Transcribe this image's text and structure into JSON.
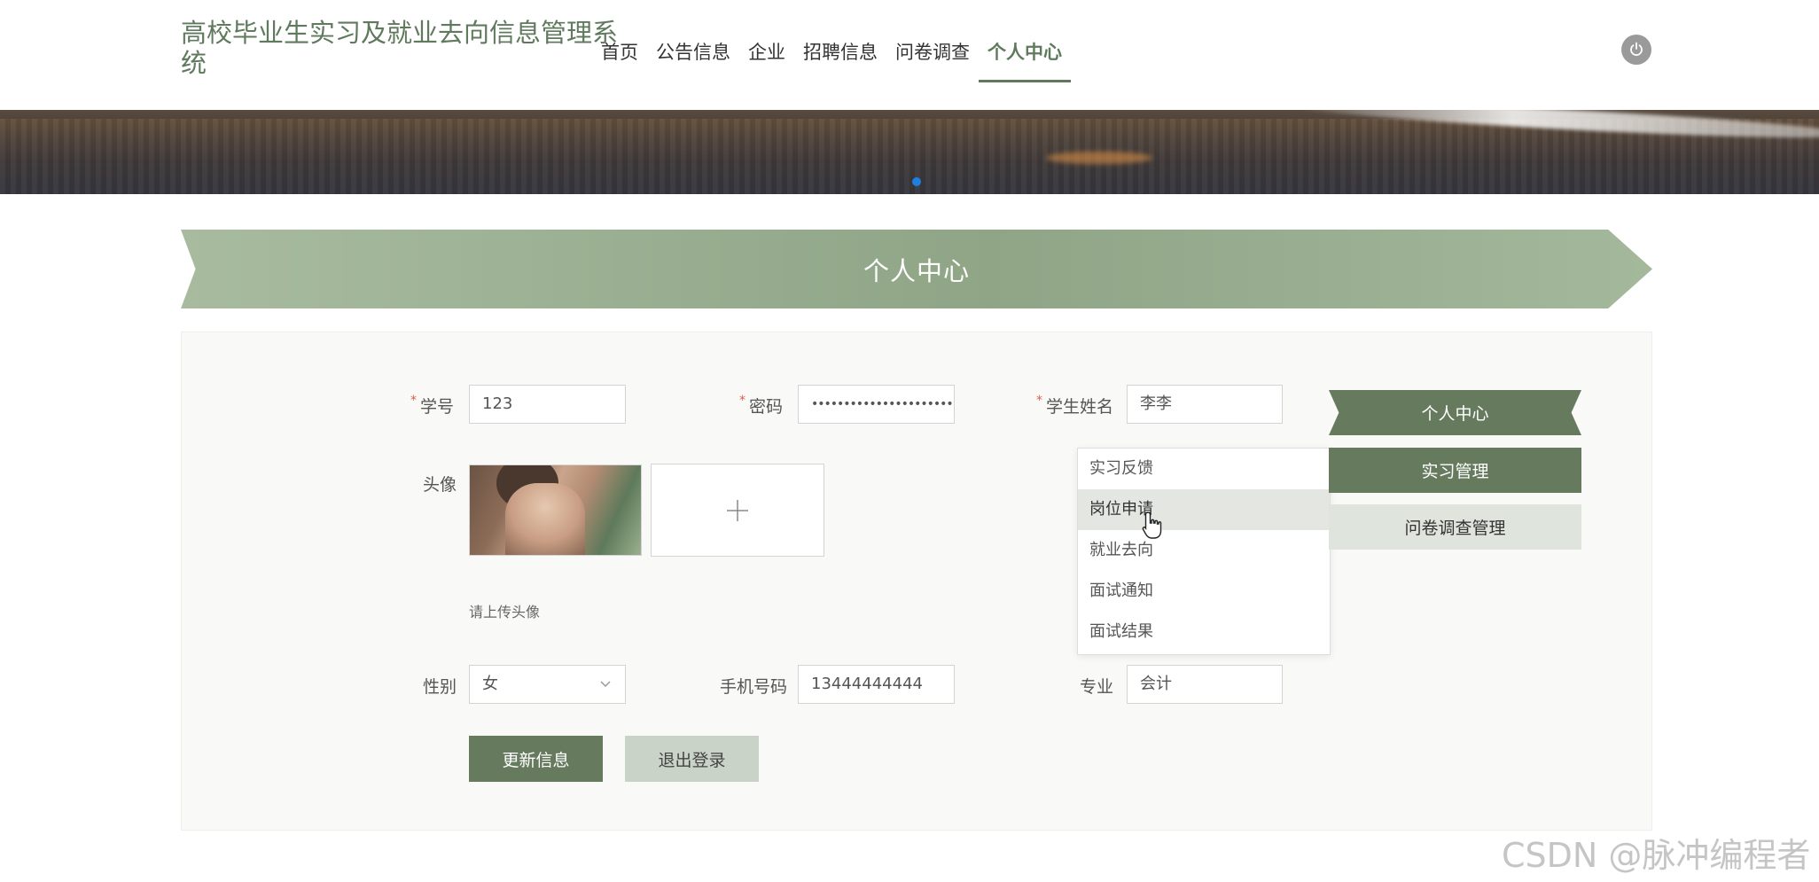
{
  "header": {
    "title": "高校毕业生实习及就业去向信息管理系统",
    "nav": [
      {
        "label": "首页"
      },
      {
        "label": "公告信息"
      },
      {
        "label": "企业"
      },
      {
        "label": "招聘信息"
      },
      {
        "label": "问卷调查"
      },
      {
        "label": "个人中心",
        "active": true
      }
    ],
    "power_icon": "power-icon"
  },
  "banner": {
    "slide_index": 1,
    "slide_count": 1
  },
  "section": {
    "title": "个人中心"
  },
  "form": {
    "student_id": {
      "label": "学号",
      "required": true,
      "value": "123"
    },
    "password": {
      "label": "密码",
      "required": true,
      "value": "••••••••••••••••••••••"
    },
    "student_name": {
      "label": "学生姓名",
      "required": true,
      "value": "李李"
    },
    "avatar": {
      "label": "头像",
      "hint": "请上传头像",
      "upload_icon": "plus-icon"
    },
    "gender": {
      "label": "性别",
      "value": "女"
    },
    "phone": {
      "label": "手机号码",
      "value": "13444444444"
    },
    "major": {
      "label": "专业",
      "value": "会计"
    },
    "update_button": "更新信息",
    "logout_button": "退出登录"
  },
  "dropdown": {
    "items": [
      {
        "label": "实习反馈"
      },
      {
        "label": "岗位申请",
        "hover": true
      },
      {
        "label": "就业去向"
      },
      {
        "label": "面试通知"
      },
      {
        "label": "面试结果"
      }
    ]
  },
  "side_menu": {
    "title": "个人中心",
    "items": [
      {
        "label": "实习管理",
        "active": true
      },
      {
        "label": "问卷调查管理",
        "active": false
      }
    ]
  },
  "watermark": "CSDN @脉冲编程者",
  "colors": {
    "accent": "#667a5e",
    "required": "#e05c4b",
    "active_dot": "#1e7fe0"
  }
}
